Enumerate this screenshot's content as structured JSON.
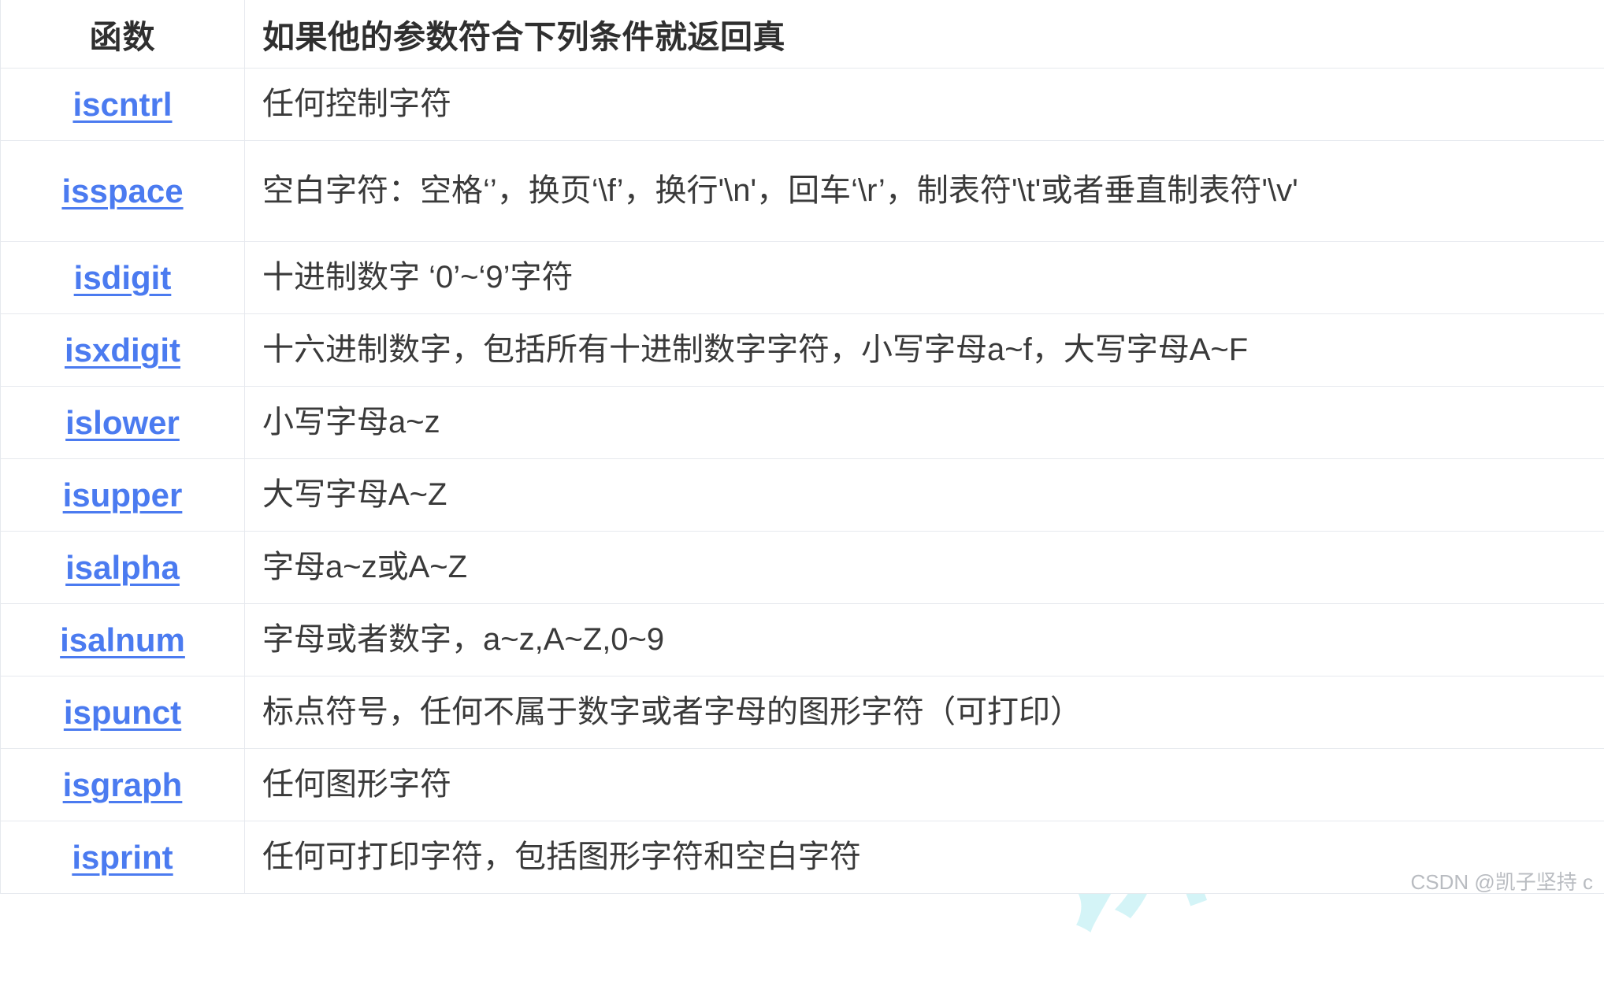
{
  "table": {
    "headers": {
      "function": "函数",
      "description": "如果他的参数符合下列条件就返回真"
    },
    "rows": [
      {
        "fn": "iscntrl",
        "desc": "任何控制字符"
      },
      {
        "fn": "isspace",
        "desc": "空白字符：空格‘’，换页‘\\f’，换行'\\n'，回车‘\\r’，制表符'\\t'或者垂直制表符'\\v'"
      },
      {
        "fn": "isdigit",
        "desc": "十进制数字 ‘0’~‘9’字符"
      },
      {
        "fn": "isxdigit",
        "desc": "十六进制数字，包括所有十进制数字字符，小写字母a~f，大写字母A~F"
      },
      {
        "fn": "islower",
        "desc": "小写字母a~z"
      },
      {
        "fn": "isupper",
        "desc": "大写字母A~Z"
      },
      {
        "fn": "isalpha",
        "desc": "字母a~z或A~Z"
      },
      {
        "fn": "isalnum",
        "desc": "字母或者数字，a~z,A~Z,0~9"
      },
      {
        "fn": "ispunct",
        "desc": "标点符号，任何不属于数字或者字母的图形字符（可打印）"
      },
      {
        "fn": "isgraph",
        "desc": "任何图形字符"
      },
      {
        "fn": "isprint",
        "desc": "任何可打印字符，包括图形字符和空白字符"
      }
    ]
  },
  "watermark": {
    "mark_text": "课",
    "color": "#cdf3f6"
  },
  "attribution": {
    "text": "CSDN @凯子坚持 c",
    "color": "#b9bcc1"
  },
  "colors": {
    "link": "#4b7bf0",
    "text": "#3a3a3a",
    "header_text": "#2f2f2f",
    "border": "#e6e9ee",
    "background": "#ffffff"
  }
}
